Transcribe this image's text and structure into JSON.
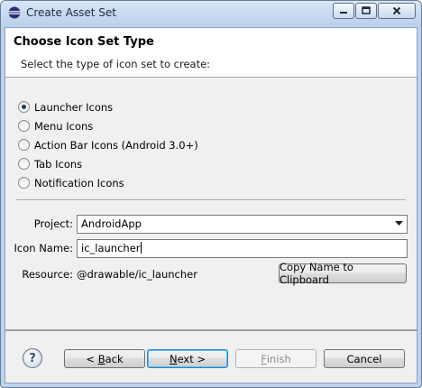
{
  "window": {
    "title": "Create Asset Set"
  },
  "header": {
    "title": "Choose Icon Set Type",
    "description": "Select the type of icon set to create:"
  },
  "icon_types": {
    "selected_index": 0,
    "options": [
      {
        "label": "Launcher Icons"
      },
      {
        "label": "Menu Icons"
      },
      {
        "label": "Action Bar Icons (Android 3.0+)"
      },
      {
        "label": "Tab Icons"
      },
      {
        "label": "Notification Icons"
      }
    ]
  },
  "form": {
    "project_label": "Project:",
    "project_value": "AndroidApp",
    "icon_name_label": "Icon Name:",
    "icon_name_value": "ic_launcher",
    "resource_label": "Resource:",
    "resource_value": "@drawable/ic_launcher",
    "copy_button": "Copy Name to Clipboard"
  },
  "footer": {
    "back_prefix": "< ",
    "back_key": "B",
    "back_rest": "ack",
    "next_key": "N",
    "next_rest": "ext >",
    "finish_key": "F",
    "finish_rest": "inish",
    "cancel": "Cancel",
    "help_glyph": "?"
  }
}
